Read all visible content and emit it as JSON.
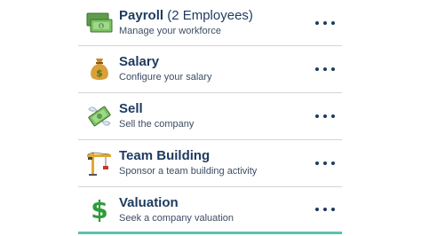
{
  "menu": {
    "items": [
      {
        "title": "Payroll",
        "title_extra": " (2 Employees)",
        "subtitle": "Manage your workforce",
        "icon": "money-bills-icon"
      },
      {
        "title": "Salary",
        "title_extra": "",
        "subtitle": "Configure your salary",
        "icon": "money-bag-icon"
      },
      {
        "title": "Sell",
        "title_extra": "",
        "subtitle": "Sell the company",
        "icon": "money-with-wings-icon"
      },
      {
        "title": "Team Building",
        "title_extra": "",
        "subtitle": "Sponsor a team building activity",
        "icon": "crane-icon"
      },
      {
        "title": "Valuation",
        "title_extra": "",
        "subtitle": "Seek a company valuation",
        "icon": "dollar-sign-icon"
      }
    ]
  },
  "colors": {
    "title": "#1d3a5f",
    "subtitle": "#3c4d63",
    "divider": "#d4d4d4",
    "accent": "#5cc2b0"
  }
}
